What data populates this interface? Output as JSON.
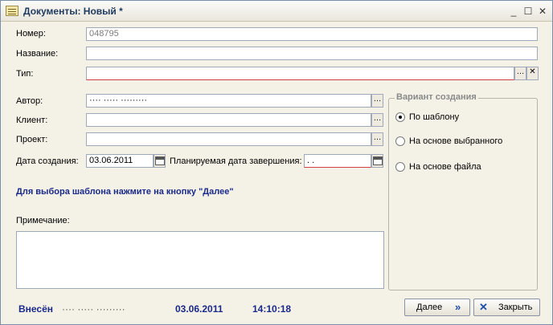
{
  "window": {
    "title": "Документы: Новый *"
  },
  "fields": {
    "number_label": "Номер:",
    "number_value": "048795",
    "name_label": "Название:",
    "name_value": "",
    "type_label": "Тип:",
    "type_value": "",
    "author_label": "Автор:",
    "author_value": "···· ····· ·········",
    "client_label": "Клиент:",
    "client_value": "",
    "project_label": "Проект:",
    "project_value": "",
    "created_label": "Дата создания:",
    "created_value": "03.06.2011",
    "planned_label": "Планируемая дата завершения:",
    "planned_value": ". .",
    "hint": "Для выбора шаблона нажмите на кнопку \"Далее\"",
    "note_label": "Примечание:"
  },
  "variant": {
    "title": "Вариант создания",
    "options": [
      "По шаблону",
      "На основе выбранного",
      "На основе файла"
    ],
    "selected": 0
  },
  "footer": {
    "entered_label": "Внесён",
    "entered_by": "···· ····· ·········",
    "date": "03.06.2011",
    "time": "14:10:18"
  },
  "buttons": {
    "next": "Далее",
    "close": "Закрыть"
  }
}
